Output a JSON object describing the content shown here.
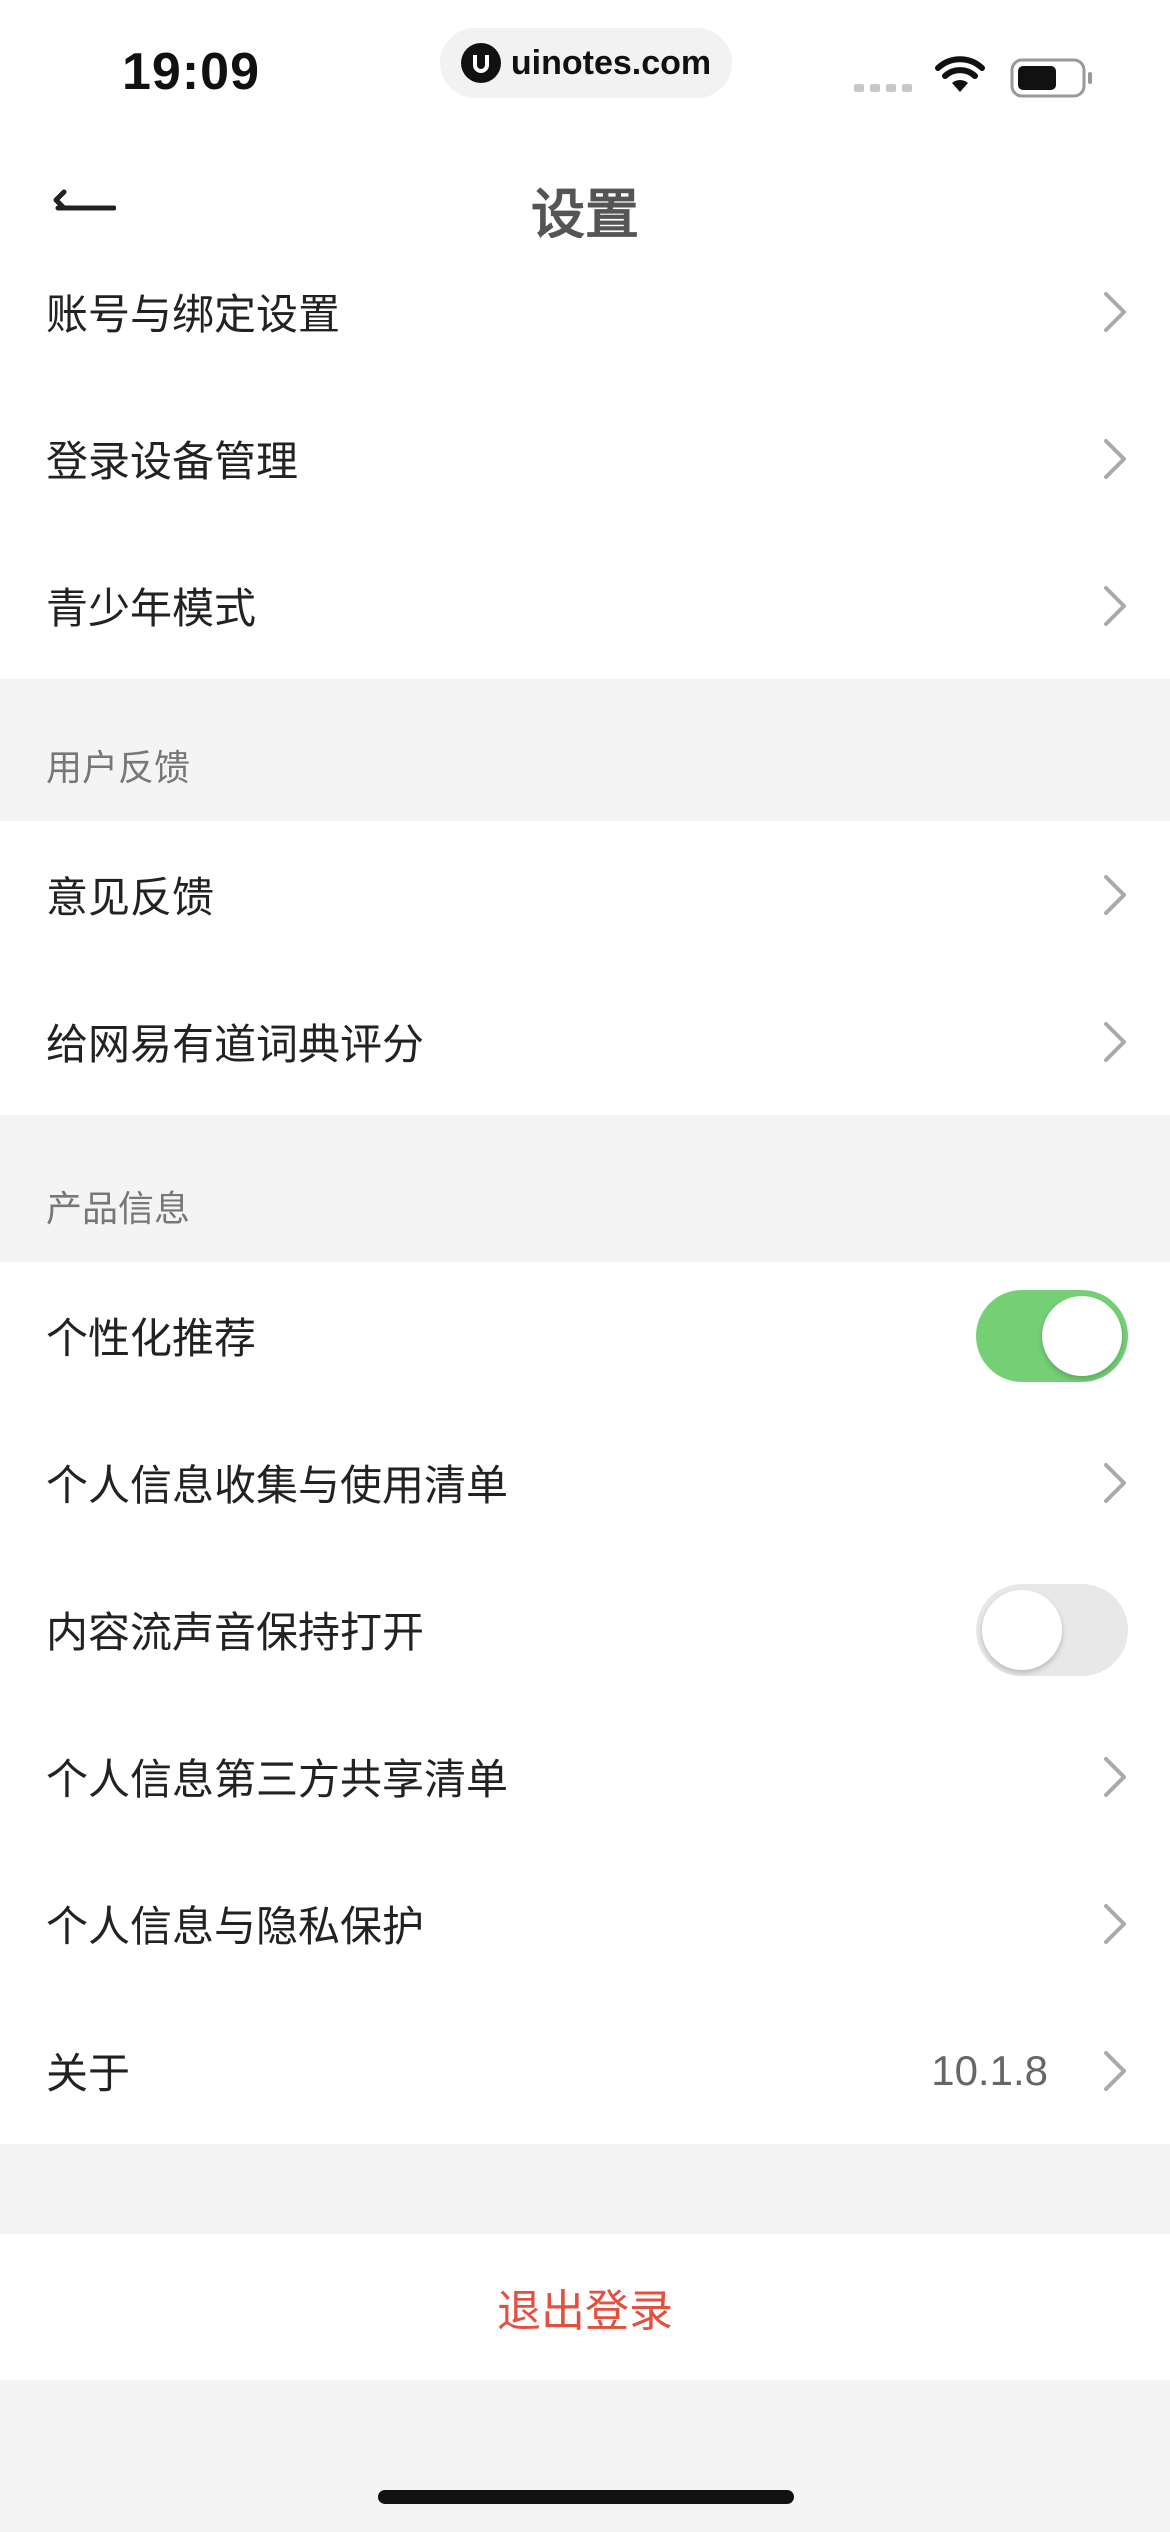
{
  "status_bar": {
    "time": "19:09",
    "url": "uinotes.com",
    "icons": [
      "signal-icon",
      "wifi-icon",
      "battery-icon"
    ]
  },
  "nav": {
    "title": "设置",
    "back_icon": "back-arrow-icon"
  },
  "account_group": {
    "items": [
      {
        "label": "账号与绑定设置"
      },
      {
        "label": "登录设备管理"
      },
      {
        "label": "青少年模式"
      }
    ]
  },
  "feedback_section": {
    "header": "用户反馈",
    "items": [
      {
        "label": "意见反馈"
      },
      {
        "label": "给网易有道词典评分"
      }
    ]
  },
  "product_section": {
    "header": "产品信息",
    "items": [
      {
        "label": "个性化推荐",
        "toggle": true
      },
      {
        "label": "个人信息收集与使用清单"
      },
      {
        "label": "内容流声音保持打开",
        "toggle": false
      },
      {
        "label": "个人信息第三方共享清单"
      },
      {
        "label": "个人信息与隐私保护"
      },
      {
        "label": "关于",
        "value": "10.1.8"
      }
    ]
  },
  "logout": {
    "label": "退出登录"
  },
  "colors": {
    "toggle_on": "#75d075",
    "logout_text": "#e2513f",
    "page_bg": "#f4f4f4"
  }
}
